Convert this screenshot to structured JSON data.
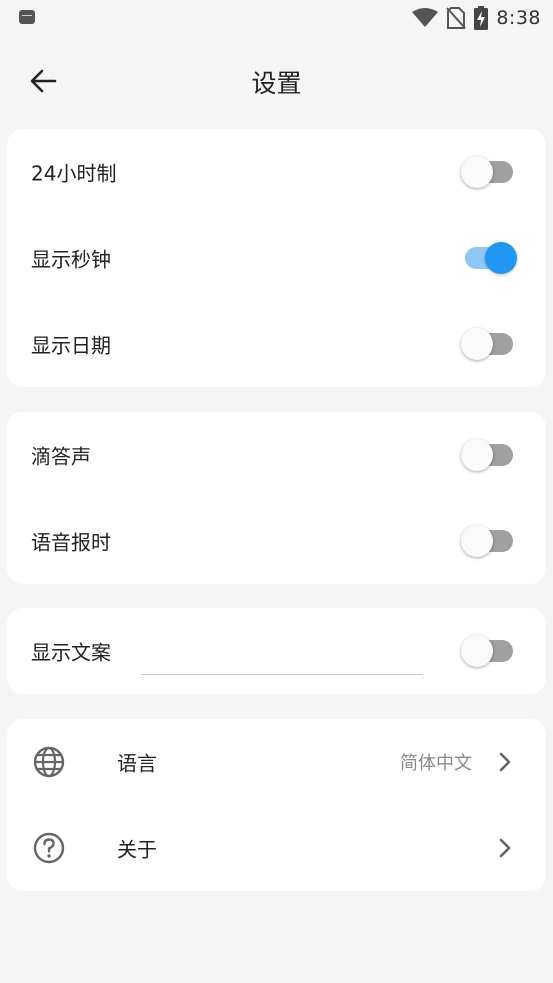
{
  "status_bar": {
    "time": "8:38",
    "icons": [
      "app-notification-icon",
      "wifi-icon",
      "no-sim-icon",
      "battery-charging-icon"
    ]
  },
  "header": {
    "title": "设置",
    "back_icon": "arrow-left-icon"
  },
  "sections": {
    "display": {
      "hour24": {
        "label": "24小时制",
        "enabled": false
      },
      "show_seconds": {
        "label": "显示秒钟",
        "enabled": true
      },
      "show_date": {
        "label": "显示日期",
        "enabled": false
      }
    },
    "sound": {
      "tick": {
        "label": "滴答声",
        "enabled": false
      },
      "voice_chime": {
        "label": "语音报时",
        "enabled": false
      }
    },
    "copy": {
      "show_copy": {
        "label": "显示文案",
        "enabled": false,
        "value": "",
        "placeholder": ""
      }
    },
    "misc": {
      "language": {
        "label": "语言",
        "value": "简体中文",
        "icon": "globe-icon"
      },
      "about": {
        "label": "关于",
        "icon": "help-circle-icon"
      }
    }
  },
  "colors": {
    "accent": "#2196f3",
    "accent_track": "#8fc7f5",
    "background": "#f5f5f5",
    "card": "#ffffff"
  }
}
